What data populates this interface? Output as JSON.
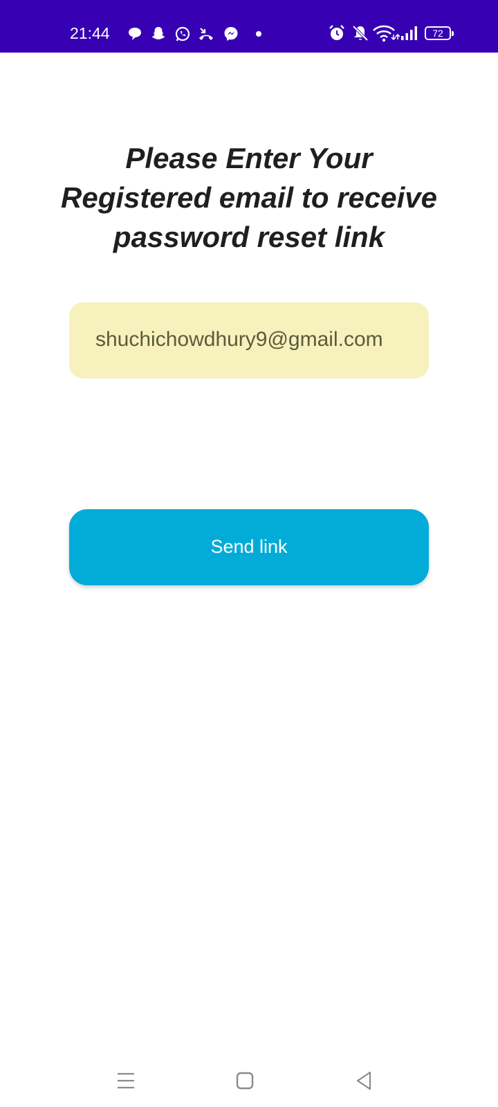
{
  "status_bar": {
    "time": "21:44",
    "battery": "72",
    "left_icons": [
      "chat-bubble-icon",
      "snapchat-icon",
      "whatsapp-icon",
      "missed-call-icon",
      "messenger-icon",
      "dot-icon"
    ],
    "right_icons": [
      "alarm-icon",
      "muted-bell-icon",
      "wifi-icon",
      "signal-icon",
      "battery-icon"
    ],
    "background": "#3700b3"
  },
  "main": {
    "heading_lines": [
      "Please Enter Your",
      "Registered email to receive",
      "password reset link"
    ],
    "email_value": "shuchichowdhury9@gmail.com",
    "send_label": "Send link"
  },
  "nav_bar": {
    "icons": [
      "menu-icon",
      "home-icon",
      "back-icon"
    ]
  },
  "colors": {
    "accent": "#03acd8",
    "field_bg": "#f7f1bd",
    "heading": "#1f1f1f"
  }
}
